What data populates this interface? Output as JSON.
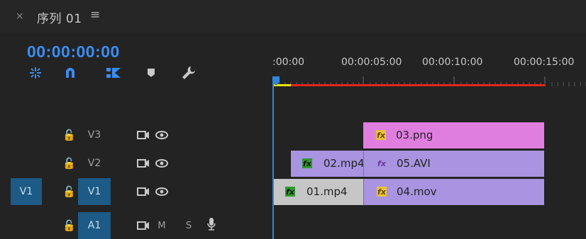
{
  "panel": {
    "close_glyph": "×",
    "title": "序列 01",
    "menu_glyph": "≡"
  },
  "timecode": "00:00:00:00",
  "tools": [
    "snap-icon",
    "magnet-icon",
    "linked-selection-icon",
    "marker-icon",
    "wrench-icon"
  ],
  "ruler": {
    "labels": [
      ":00:00",
      "00:00:05:00",
      "00:00:10:00",
      "00:00:15:00"
    ]
  },
  "tracks": [
    {
      "name": "V3",
      "source": "",
      "lock": "🔓",
      "kind": "video"
    },
    {
      "name": "V2",
      "source": "",
      "lock": "🔓",
      "kind": "video"
    },
    {
      "name": "V1",
      "source": "V1",
      "lock": "🔓",
      "kind": "video"
    },
    {
      "name": "A1",
      "source": "",
      "lock": "🔓",
      "kind": "audio",
      "mute": "M",
      "solo": "S"
    }
  ],
  "clips": {
    "v3_a": "03.png",
    "v2_a": "02.mp4",
    "v2_b": "05.AVI",
    "v1_a": "01.mp4",
    "v1_b": "04.mov"
  },
  "fx_label": "fx",
  "colors": {
    "accent": "#2f86de",
    "pink_clip": "#e07ee0",
    "purple_clip": "#a894e0",
    "gray_clip": "#c6c6c6",
    "work_area": "#e8241c"
  }
}
